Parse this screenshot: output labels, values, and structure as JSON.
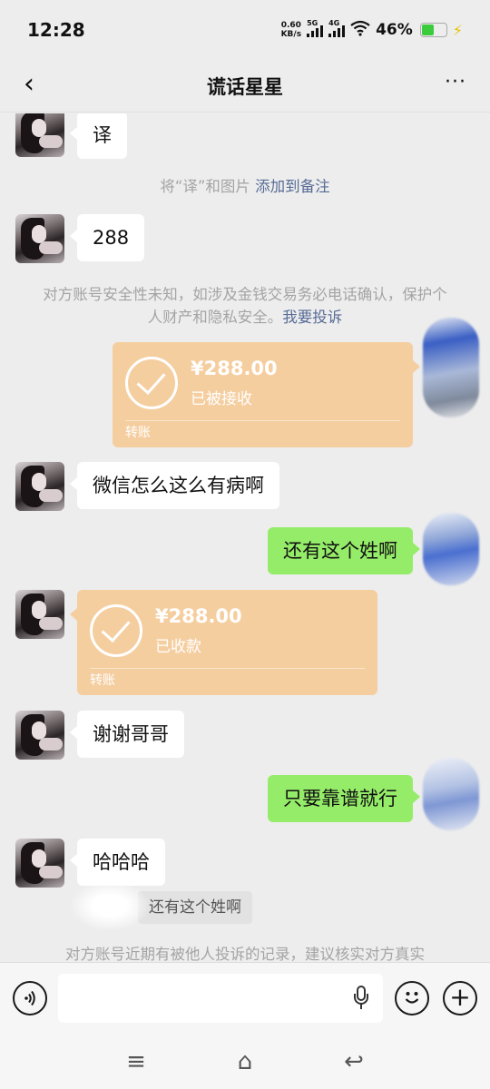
{
  "status_bar": {
    "time": "12:28",
    "net_speed_value": "0.60",
    "net_speed_unit": "KB/s",
    "sim1_label": "5G",
    "sim2_label": "4G",
    "battery_percent": "46%",
    "battery_level": 0.46
  },
  "header": {
    "title": "谎话星星",
    "back_icon": "‹",
    "more_icon": "···"
  },
  "messages": {
    "m1": "译",
    "sys1_text": "将“译”和图片 ",
    "sys1_link": "添加到备注",
    "m2": "288",
    "sys2_text": "对方账号安全性未知，如涉及金钱交易务必电话确认，保护个人财产和隐私安全。",
    "sys2_link": "我要投诉",
    "transfer1": {
      "amount": "¥288.00",
      "status": "已被接收",
      "label": "转账"
    },
    "m3": "微信怎么这么有病啊",
    "m4": "还有这个姓啊",
    "transfer2": {
      "amount": "¥288.00",
      "status": "已收款",
      "label": "转账"
    },
    "m5": "谢谢哥哥",
    "m6": "只要靠谱就行",
    "m7": "哈哈哈",
    "quote": "还有这个姓啊",
    "sys3_text": "对方账号近期有被他人投诉的记录，建议核实对方真实"
  },
  "input_bar": {
    "placeholder": "",
    "voice_icon": "voice-icon",
    "emoji_icon": "emoji-icon",
    "plus_icon": "plus-icon"
  },
  "system_nav": {
    "menu_icon": "≡",
    "home_icon": "⌂",
    "back_icon": "↩"
  },
  "colors": {
    "background": "#ededed",
    "bubble_in": "#ffffff",
    "bubble_out": "#95ec69",
    "transfer": "#f5cea0",
    "link": "#576b95",
    "system_text": "#a4a4a4"
  }
}
